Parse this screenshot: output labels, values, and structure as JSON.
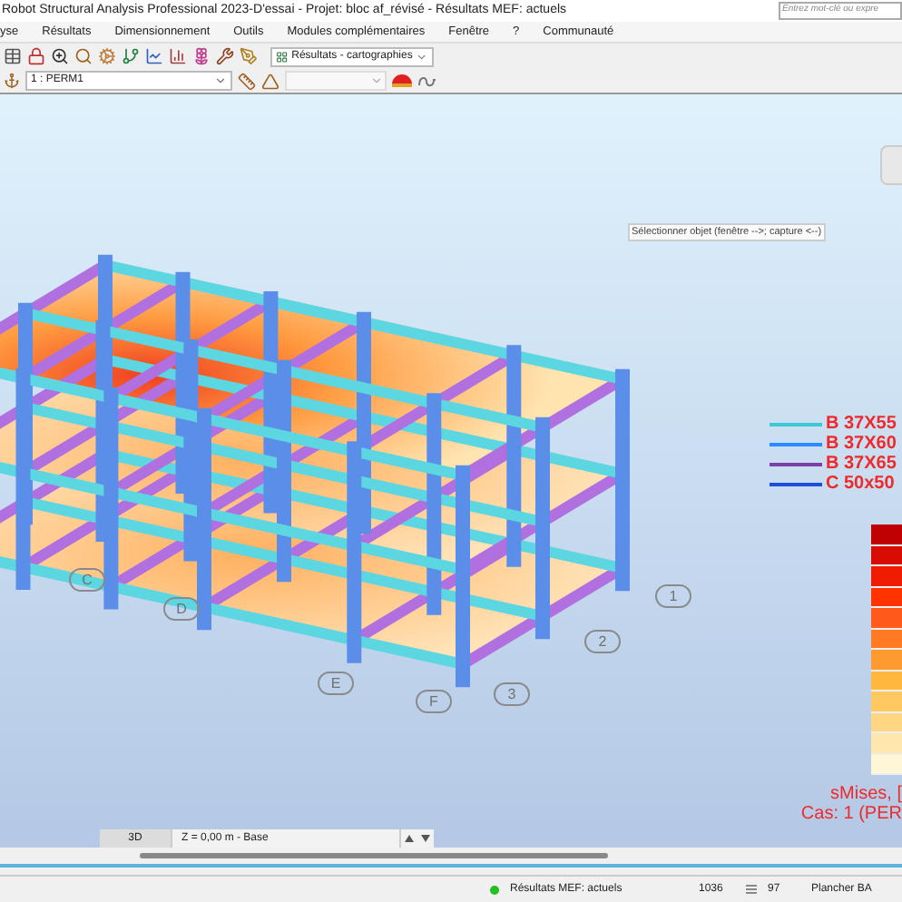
{
  "window": {
    "title": "Robot Structural Analysis Professional 2023-D'essai - Projet: bloc af_révisé - Résultats MEF: actuels"
  },
  "search": {
    "placeholder": "Entrez mot-clé ou expre"
  },
  "menu": [
    "yse",
    "Résultats",
    "Dimensionnement",
    "Outils",
    "Modules complémentaires",
    "Fenêtre",
    "?",
    "Communauté"
  ],
  "toolbar": {
    "view_dropdown": "Résultats - cartographies",
    "case_dropdown": "1 : PERM1"
  },
  "viewport": {
    "tooltip": "Sélectionner objet (fenêtre -->; capture <--)",
    "grid_labels": [
      "C",
      "D",
      "E",
      "F",
      "1",
      "2",
      "3"
    ],
    "legend": [
      {
        "label": "B 37X55",
        "color": "#3cc8d4"
      },
      {
        "label": "B 37X60",
        "color": "#2b8cff"
      },
      {
        "label": "B 37X65",
        "color": "#7b3fa8"
      },
      {
        "label": "C 50x50",
        "color": "#1e4fd8"
      }
    ],
    "scale": [
      {
        "color": "#c00000"
      },
      {
        "color": "#d80c00"
      },
      {
        "color": "#f01c00"
      },
      {
        "color": "#ff3300"
      },
      {
        "color": "#ff5a1a"
      },
      {
        "color": "#ff7a22"
      },
      {
        "color": "#ff9a30"
      },
      {
        "color": "#ffb73d"
      },
      {
        "color": "#ffc860"
      },
      {
        "color": "#ffd684"
      },
      {
        "color": "#ffe6ad"
      },
      {
        "color": "#fff6d8"
      }
    ],
    "caption": [
      "sMises, [",
      "Cas: 1 (PER"
    ]
  },
  "view_tabs": [
    {
      "label": "3D",
      "selected": true
    },
    {
      "label": "Z = 0,00 m - Base",
      "selected": false
    }
  ],
  "status_bar": {
    "results": "Résultats MEF: actuels",
    "results_ok": true,
    "count": "1036",
    "value": "97",
    "material": "Plancher BA"
  }
}
